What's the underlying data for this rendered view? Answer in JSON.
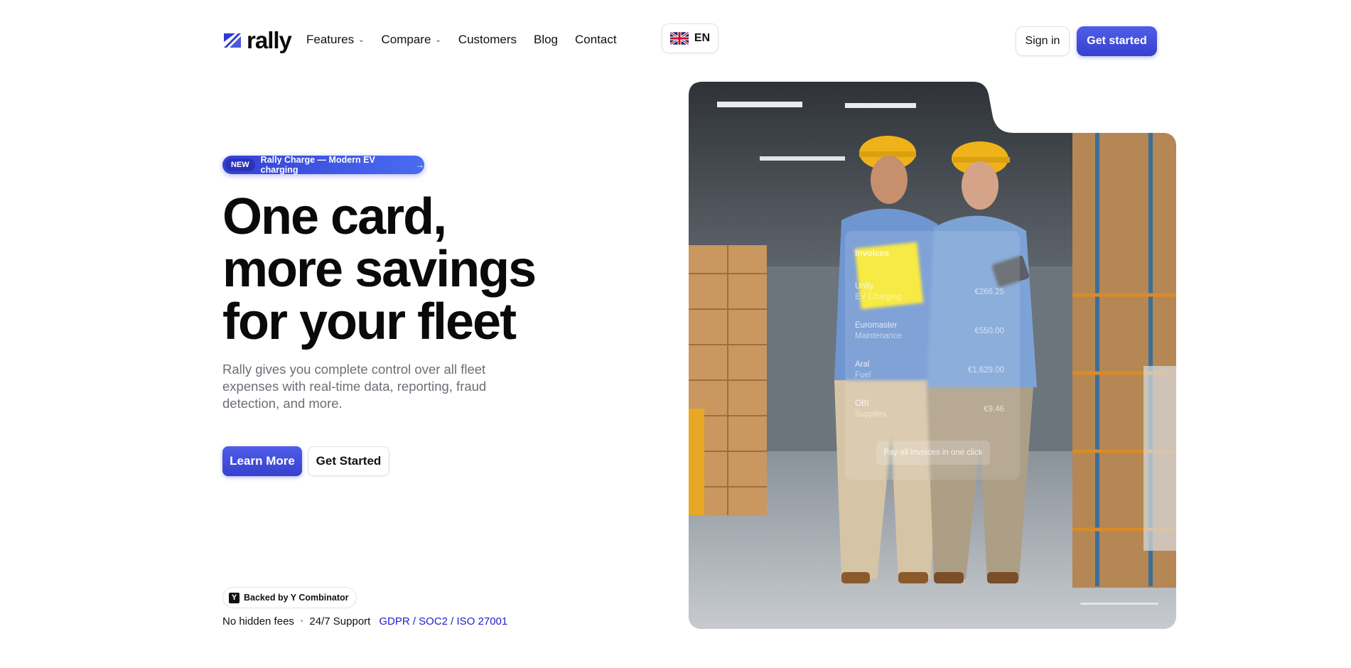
{
  "nav": {
    "logo_text": "rally",
    "menu": [
      {
        "label": "Features",
        "has_dropdown": true
      },
      {
        "label": "Compare",
        "has_dropdown": true
      },
      {
        "label": "Customers",
        "has_dropdown": false
      },
      {
        "label": "Blog",
        "has_dropdown": false
      },
      {
        "label": "Contact",
        "has_dropdown": false
      }
    ],
    "language": "EN",
    "sign_in": "Sign in",
    "get_started": "Get started"
  },
  "hero": {
    "pill_badge": "NEW",
    "pill_text": "Rally Charge — Modern EV charging",
    "headline_lines": [
      "One card,",
      "more savings",
      "for your fleet"
    ],
    "subtitle": "Rally gives you complete control over all fleet expenses with real-time data, reporting, fraud detection, and more.",
    "primary_cta": "Learn More",
    "secondary_cta": "Get Started",
    "backed_by": "Backed by Y Combinator",
    "yc_letter": "Y",
    "trust": {
      "item1": "No hidden fees",
      "item2": "24/7 Support",
      "certs": "GDPR / SOC2 / ISO 27001"
    }
  },
  "invoice_overlay": {
    "title": "Invoices",
    "rows": [
      {
        "name": "Unity",
        "category": "EV Charging",
        "amount": "€266.25"
      },
      {
        "name": "Euromaster",
        "category": "Maintenance",
        "amount": "€550.00"
      },
      {
        "name": "Aral",
        "category": "Fuel",
        "amount": "€1,629.00"
      },
      {
        "name": "OBI",
        "category": "Supplies",
        "amount": "€9.46"
      }
    ],
    "pay_button": "Pay all invoices in one click"
  },
  "colors": {
    "brand": "#3740cf",
    "brand_light": "#4f5ee8",
    "cert_link": "#2020c8",
    "subtitle": "#6b6f76"
  }
}
